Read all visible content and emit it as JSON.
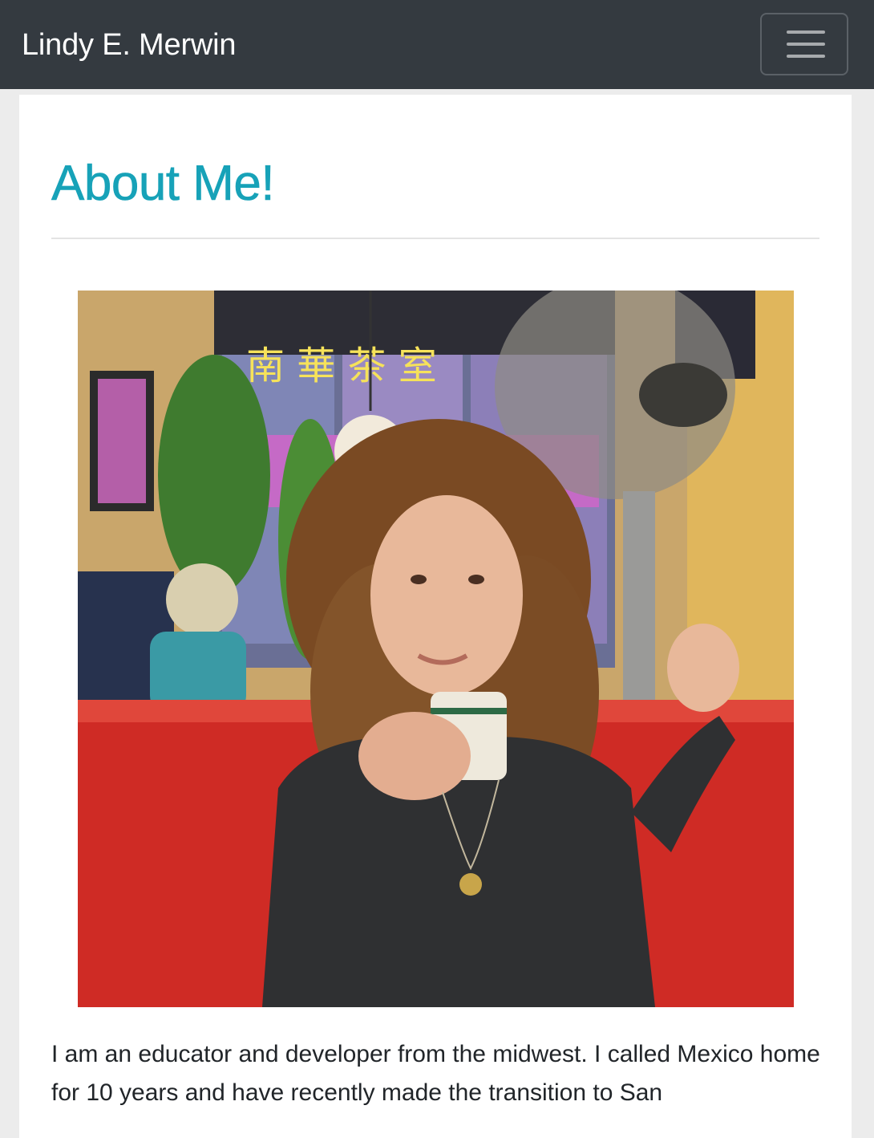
{
  "navbar": {
    "brand": "Lindy E. Merwin",
    "toggler_icon": "hamburger-menu-icon"
  },
  "about": {
    "heading": "About Me!",
    "photo_alt": "Photo of Lindy E. Merwin",
    "bio": "I am an educator and developer from the midwest. I called Mexico home for 10 years and have recently made the transition to San"
  },
  "colors": {
    "navbar_bg": "#343a40",
    "heading": "#17a2b8",
    "page_bg": "#ececec"
  }
}
